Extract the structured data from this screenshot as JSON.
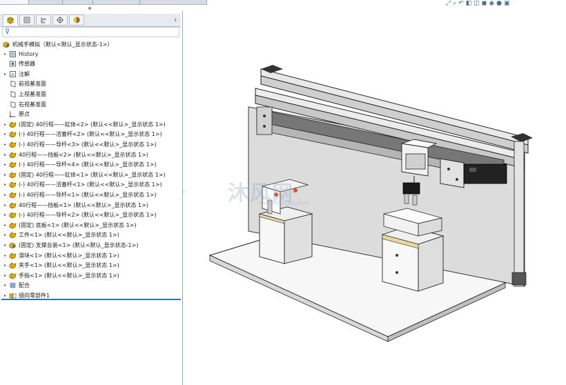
{
  "top_tabs": [
    "",
    "",
    "",
    "",
    ""
  ],
  "tree_root": "机械手模拟（默认<默认_显示状态-1>）",
  "tree_items": [
    {
      "label": "History",
      "icon": "history-icon",
      "expand": true
    },
    {
      "label": "传感器",
      "icon": "sensor-icon",
      "expand": false
    },
    {
      "label": "注解",
      "icon": "annotation-icon",
      "expand": true
    },
    {
      "label": "前视基准面",
      "icon": "plane-icon",
      "expand": false
    },
    {
      "label": "上视基准面",
      "icon": "plane-icon",
      "expand": false
    },
    {
      "label": "右视基准面",
      "icon": "plane-icon",
      "expand": false
    },
    {
      "label": "原点",
      "icon": "origin-icon",
      "expand": false
    },
    {
      "label": "(固定) 40行程——缸体<2> (默认<<默认>_显示状态 1>)",
      "icon": "part-icon",
      "expand": true
    },
    {
      "label": "(-) 40行程——活塞杆<2> (默认<<默认>_显示状态 1>)",
      "icon": "part-icon",
      "expand": true
    },
    {
      "label": "(-) 40行程——导杆<3> (默认<<默认>_显示状态 1>)",
      "icon": "part-icon",
      "expand": true
    },
    {
      "label": "40行程——挡板<2> (默认<<默认>_显示状态 1>)",
      "icon": "part-icon",
      "expand": true
    },
    {
      "label": "(-) 40行程——导杆<4> (默认<<默认>_显示状态 1>)",
      "icon": "part-icon",
      "expand": true
    },
    {
      "label": "(固定) 40行程——缸体<1> (默认<<默认>_显示状态 1>)",
      "icon": "part-icon",
      "expand": true
    },
    {
      "label": "(-) 40行程——活塞杆<1> (默认<<默认>_显示状态 1>)",
      "icon": "part-icon",
      "expand": true
    },
    {
      "label": "(-) 40行程——导杆<1> (默认<<默认>_显示状态 1>)",
      "icon": "part-icon",
      "expand": true
    },
    {
      "label": "40行程——挡板<1> (默认<<默认>_显示状态 1>)",
      "icon": "part-icon",
      "expand": true
    },
    {
      "label": "(-) 40行程——导杆<2> (默认<<默认>_显示状态 1>)",
      "icon": "part-icon",
      "expand": true
    },
    {
      "label": "(固定) 底板<1> (默认<<默认>_显示状态 1>)",
      "icon": "part-icon",
      "expand": true
    },
    {
      "label": "工件<1> (默认<<默认>_显示状态 1>)",
      "icon": "part-icon",
      "expand": true
    },
    {
      "label": "(固定) 支撑总装<1> (默认<默认_显示状态-1>)",
      "icon": "assembly-icon",
      "expand": true
    },
    {
      "label": "滑块<1> (默认<<默认>_显示状态 1>)",
      "icon": "part-icon",
      "expand": true
    },
    {
      "label": "夹手<1> (默认<<默认>_显示状态 1>)",
      "icon": "part-icon",
      "expand": true
    },
    {
      "label": "手指<1> (默认<<默认>_显示状态 1>)",
      "icon": "part-icon",
      "expand": true
    },
    {
      "label": "配合",
      "icon": "mate-icon",
      "expand": true
    },
    {
      "label": "镜向零部件1",
      "icon": "mirror-icon",
      "expand": true
    }
  ],
  "watermark": {
    "main": "沐风网",
    "sub": "www.mfcad.com"
  },
  "colors": {
    "accent": "#2d6fb0",
    "part_yellow": "#e8b400",
    "panel_border": "#9ea7b3"
  }
}
